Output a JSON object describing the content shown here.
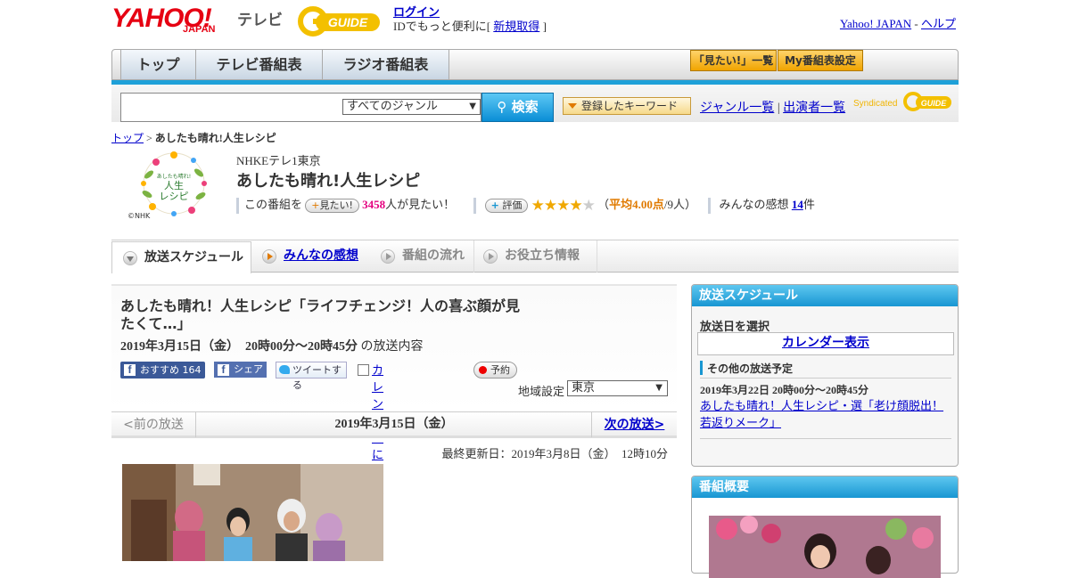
{
  "header": {
    "yahoo_logo": "YAHOO!",
    "japan": "JAPAN",
    "tv": "テレビ",
    "gguide_logo": "G GUIDE",
    "login": "ログイン",
    "login_desc": "IDでもっと便利に[",
    "signup": "新規取得",
    "bracket_close": "]",
    "yahoo_japan_link": "Yahoo! JAPAN",
    "separator": "-",
    "help": "ヘルプ"
  },
  "nav": {
    "tabs": [
      "トップ",
      "テレビ番組表",
      "ラジオ番組表"
    ],
    "mitai_list": "「見たい!」一覧",
    "my_schedule": "My番組表設定"
  },
  "search": {
    "placeholder": "",
    "genre": "すべてのジャンル",
    "button": "検索",
    "keyword_button": "登録したキーワード",
    "genre_list": "ジャンル一覧",
    "pipe": "|",
    "performer_list": "出演者一覧",
    "syndicated": "Syndicated"
  },
  "breadcrumb": {
    "top": "トップ",
    "sep": ">",
    "current": "あしたも晴れ!人生レシピ"
  },
  "program": {
    "logo_text": "あしたも晴れ! 人生 レシピ",
    "copyright": "©NHK",
    "channel": "NHKEテレ1東京",
    "title": "あしたも晴れ!人生レシピ",
    "this_program": "この番組を",
    "mitai_btn": "見たい!",
    "mitai_count": "3458",
    "mitai_suffix": "人が見たい！",
    "rate_btn": "評価",
    "rating": 4.0,
    "avg_open": "（",
    "avg_label": "平均4.00点",
    "avg_rest": "/9人）",
    "comments_label": "みんなの感想",
    "comments_count": "14",
    "comments_suffix": "件"
  },
  "subtabs": [
    "放送スケジュール",
    "みんなの感想",
    "番組の流れ",
    "お役立ち情報"
  ],
  "episode": {
    "title": "あしたも晴れ！人生レシピ「ライフチェンジ！人の喜ぶ顔が見たくて…」",
    "date": "2019年3月15日（金）　20時00分～20時45分",
    "date_suffix": "の放送内容",
    "fb_recommend": "おすすめ",
    "fb_count": "164",
    "fb_share": "シェア",
    "tweet": "ツイートする",
    "calendar": "カレンダーに登録",
    "reserve": "予約",
    "region_label": "地域設定",
    "region": "東京"
  },
  "pager": {
    "prev": "<前の放送",
    "current": "2019年3月15日（金）",
    "next": "次の放送>"
  },
  "updated": "最終更新日：2019年3月8日（金）　12時10分",
  "sidebar": {
    "schedule_title": "放送スケジュール",
    "select_date": "放送日を選択",
    "calendar_view": "カレンダー表示",
    "other_broadcasts": "その他の放送予定",
    "next_date": "2019年3月22日  20時00分～20時45分",
    "next_title": "あしたも晴れ！人生レシピ・選「老け顔脱出！若返りメーク」",
    "overview_title": "番組概要"
  },
  "colors": {
    "accent_blue": "#1896d2",
    "yahoo_red": "#e60012",
    "pink": "#e4007f",
    "star": "#f0a800"
  }
}
